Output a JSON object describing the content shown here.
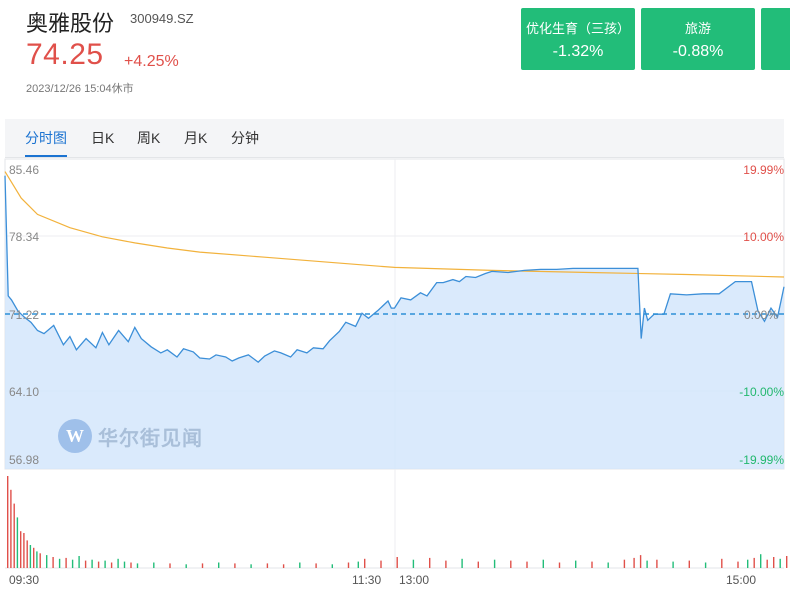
{
  "stock": {
    "name": "奥雅股份",
    "code": "300949.SZ",
    "price": "74.25",
    "change": "+4.25%",
    "timestamp": "2023/12/26 15:04休市"
  },
  "sectors": [
    {
      "name": "优化生育（三孩）",
      "change": "-1.32%"
    },
    {
      "name": "旅游",
      "change": "-0.88%"
    }
  ],
  "tabs": [
    {
      "label": "分时图",
      "active": true
    },
    {
      "label": "日K",
      "active": false
    },
    {
      "label": "周K",
      "active": false
    },
    {
      "label": "月K",
      "active": false
    },
    {
      "label": "分钟",
      "active": false
    }
  ],
  "watermark": {
    "text": "华尔街见闻"
  },
  "colors": {
    "up": "#e0504a",
    "down": "#22bd79",
    "price_line": "#3c8fd8",
    "avg_line": "#f2b23c",
    "fill": "#d4e6fb",
    "active_tab": "#1b73d1"
  },
  "chart_data": {
    "type": "line",
    "y_ticks_left": [
      "85.46",
      "78.34",
      "71.22",
      "64.10",
      "56.98"
    ],
    "y_ticks_right": [
      "19.99%",
      "10.00%",
      "0.00%",
      "-10.00%",
      "-19.99%"
    ],
    "x_ticks": [
      "09:30",
      "11:30",
      "13:00",
      "15:00"
    ],
    "ylim": [
      56.98,
      85.46
    ],
    "prev_close": 71.22,
    "minutes": 240,
    "series": [
      {
        "values_key": "price",
        "x": [
          0,
          1,
          2,
          4,
          6,
          8,
          10,
          12,
          15,
          18,
          20,
          22,
          25,
          28,
          30,
          32,
          35,
          38,
          40,
          42,
          45,
          48,
          50,
          53,
          55,
          58,
          60,
          63,
          65,
          68,
          70,
          72,
          75,
          78,
          80,
          83,
          85,
          88,
          90,
          93,
          95,
          98,
          100,
          103,
          105,
          108,
          110,
          112,
          115,
          118,
          119,
          120,
          122,
          125,
          128,
          130,
          133,
          135,
          138,
          140,
          142,
          145,
          148,
          150,
          155,
          160,
          165,
          170,
          175,
          180,
          185,
          190,
          193,
          195,
          196,
          197,
          198,
          200,
          203,
          205,
          210,
          215,
          220,
          225,
          228,
          230,
          232,
          234,
          236,
          238,
          239,
          240
        ],
        "values": [
          84.8,
          73.0,
          72.6,
          71.5,
          70.9,
          70.4,
          69.6,
          69.3,
          70.1,
          68.2,
          69.0,
          67.7,
          68.8,
          67.9,
          69.4,
          68.2,
          69.6,
          68.5,
          69.9,
          68.8,
          68.0,
          67.4,
          67.7,
          67.0,
          67.8,
          67.5,
          66.9,
          66.8,
          67.2,
          67.0,
          66.6,
          66.9,
          67.2,
          66.5,
          67.1,
          67.6,
          67.4,
          67.0,
          67.7,
          67.4,
          67.9,
          67.8,
          68.6,
          69.5,
          70.4,
          70.0,
          71.3,
          70.8,
          71.6,
          72.5,
          71.8,
          71.8,
          72.8,
          72.6,
          73.3,
          73.0,
          74.3,
          74.3,
          74.6,
          74.4,
          74.9,
          74.8,
          75.2,
          75.4,
          75.3,
          75.5,
          75.6,
          75.6,
          75.7,
          75.7,
          75.7,
          75.7,
          75.7,
          75.7,
          68.8,
          71.8,
          70.6,
          71.2,
          71.2,
          73.2,
          73.1,
          73.2,
          73.2,
          74.4,
          74.4,
          74.4,
          71.5,
          70.5,
          71.8,
          70.9,
          72.4,
          73.9
        ]
      },
      {
        "values_key": "average",
        "x": [
          0,
          5,
          10,
          20,
          30,
          40,
          50,
          60,
          80,
          100,
          120,
          150,
          180,
          210,
          240
        ],
        "values": [
          85.2,
          82.6,
          81.0,
          79.7,
          78.8,
          78.2,
          77.7,
          77.3,
          76.8,
          76.3,
          75.8,
          75.5,
          75.3,
          75.1,
          74.85
        ]
      }
    ],
    "volume": {
      "x": [
        0,
        1,
        2,
        3,
        4,
        5,
        6,
        7,
        8,
        9,
        10,
        12,
        14,
        16,
        18,
        20,
        22,
        24,
        26,
        28,
        30,
        32,
        34,
        36,
        38,
        40,
        45,
        50,
        55,
        60,
        65,
        70,
        75,
        80,
        85,
        90,
        95,
        100,
        105,
        108,
        110,
        115,
        120,
        125,
        130,
        135,
        140,
        145,
        150,
        155,
        160,
        165,
        170,
        175,
        180,
        185,
        190,
        193,
        195,
        197,
        200,
        205,
        210,
        215,
        220,
        225,
        228,
        230,
        232,
        234,
        236,
        238,
        240
      ],
      "values": [
        100,
        85,
        70,
        55,
        40,
        38,
        30,
        25,
        22,
        18,
        16,
        14,
        12,
        10,
        11,
        9,
        13,
        8,
        9,
        7,
        8,
        6,
        10,
        7,
        6,
        5,
        6,
        5,
        4,
        5,
        6,
        5,
        4,
        5,
        4,
        6,
        5,
        4,
        6,
        7,
        10,
        8,
        12,
        9,
        11,
        8,
        10,
        7,
        9,
        8,
        7,
        9,
        6,
        8,
        7,
        6,
        9,
        11,
        14,
        8,
        9,
        7,
        8,
        6,
        10,
        7,
        9,
        11,
        15,
        9,
        12,
        10,
        13
      ],
      "colors": [
        "up",
        "up",
        "up",
        "down",
        "up",
        "up",
        "up",
        "down",
        "up",
        "down",
        "up",
        "down",
        "up",
        "down",
        "up",
        "down",
        "down",
        "up",
        "down",
        "up",
        "down",
        "up",
        "down",
        "down",
        "up",
        "down",
        "down",
        "up",
        "down",
        "up",
        "down",
        "up",
        "down",
        "up",
        "up",
        "down",
        "up",
        "down",
        "up",
        "down",
        "up",
        "up",
        "up",
        "down",
        "up",
        "up",
        "down",
        "up",
        "down",
        "up",
        "up",
        "down",
        "up",
        "down",
        "up",
        "down",
        "up",
        "up",
        "up",
        "down",
        "up",
        "down",
        "up",
        "down",
        "up",
        "up",
        "down",
        "up",
        "down",
        "up",
        "up",
        "down",
        "up"
      ]
    }
  }
}
